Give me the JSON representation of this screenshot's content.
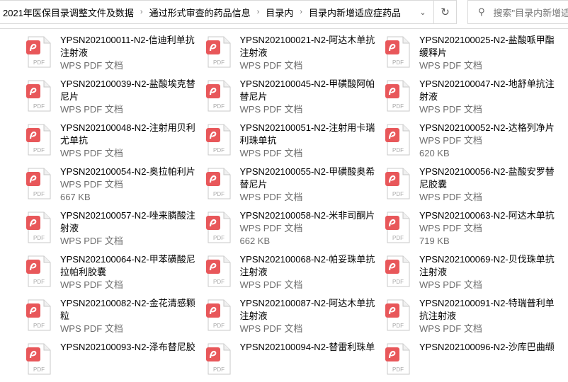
{
  "address_bar": {
    "crumbs": [
      "2021年医保目录调整文件及数据",
      "通过形式审查的药品信息",
      "目录内",
      "目录内新增适应症药品"
    ]
  },
  "search": {
    "placeholder": "搜索\"目录内新增适应症药品\""
  },
  "colors": {
    "pdf_red": "#e8575a"
  },
  "files": [
    {
      "name": "YPSN202100011-N2-信迪利单抗注射液",
      "type": "WPS PDF 文档"
    },
    {
      "name": "YPSN202100021-N2-阿达木单抗注射液",
      "type": "WPS PDF 文档"
    },
    {
      "name": "YPSN202100025-N2-盐酸哌甲酯缓释片",
      "type": "WPS PDF 文档"
    },
    {
      "name": "YPSN202100039-N2-盐酸埃克替尼片",
      "type": "WPS PDF 文档"
    },
    {
      "name": "YPSN202100045-N2-甲磺酸阿帕替尼片",
      "type": "WPS PDF 文档"
    },
    {
      "name": "YPSN202100047-N2-地舒单抗注射液",
      "type": "WPS PDF 文档"
    },
    {
      "name": "YPSN202100048-N2-注射用贝利尤单抗",
      "type": "WPS PDF 文档"
    },
    {
      "name": "YPSN202100051-N2-注射用卡瑞利珠单抗",
      "type": "WPS PDF 文档"
    },
    {
      "name": "YPSN202100052-N2-达格列净片",
      "type": "WPS PDF 文档",
      "size": "620 KB"
    },
    {
      "name": "YPSN202100054-N2-奥拉帕利片",
      "type": "WPS PDF 文档",
      "size": "667 KB"
    },
    {
      "name": "YPSN202100055-N2-甲磺酸奥希替尼片",
      "type": "WPS PDF 文档"
    },
    {
      "name": "YPSN202100056-N2-盐酸安罗替尼胶囊",
      "type": "WPS PDF 文档"
    },
    {
      "name": "YPSN202100057-N2-唑来膦酸注射液",
      "type": "WPS PDF 文档"
    },
    {
      "name": "YPSN202100058-N2-米非司酮片",
      "type": "WPS PDF 文档",
      "size": "662 KB"
    },
    {
      "name": "YPSN202100063-N2-阿达木单抗",
      "type": "WPS PDF 文档",
      "size": "719 KB"
    },
    {
      "name": "YPSN202100064-N2-甲苯磺酸尼拉帕利胶囊",
      "type": "WPS PDF 文档"
    },
    {
      "name": "YPSN202100068-N2-帕妥珠单抗注射液",
      "type": "WPS PDF 文档"
    },
    {
      "name": "YPSN202100069-N2-贝伐珠单抗注射液",
      "type": "WPS PDF 文档"
    },
    {
      "name": "YPSN202100082-N2-金花清感颗粒",
      "type": "WPS PDF 文档"
    },
    {
      "name": "YPSN202100087-N2-阿达木单抗注射液",
      "type": "WPS PDF 文档"
    },
    {
      "name": "YPSN202100091-N2-特瑞普利单抗注射液",
      "type": "WPS PDF 文档"
    },
    {
      "name": "YPSN202100093-N2-泽布替尼胶",
      "type": ""
    },
    {
      "name": "YPSN202100094-N2-替雷利珠单",
      "type": ""
    },
    {
      "name": "YPSN202100096-N2-沙库巴曲缬",
      "type": ""
    }
  ]
}
